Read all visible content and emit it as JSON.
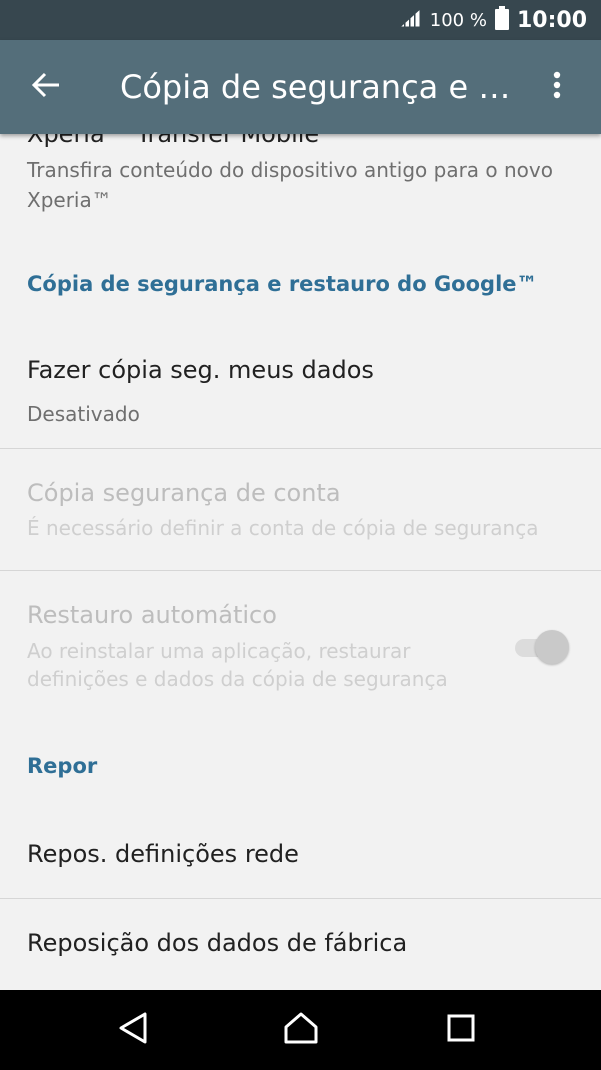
{
  "status_bar": {
    "battery_text": "100 %",
    "time": "10:00"
  },
  "app_bar": {
    "title": "Cópia de segurança e re…",
    "back_icon": "arrow-left-icon",
    "more_icon": "more-vert-icon"
  },
  "items": {
    "xperia_transfer": {
      "title": "Xperia™ Transfer Mobile",
      "summary_line1": "Transfira conteúdo do dispositivo antigo para o novo",
      "summary_line2": "Xperia™"
    },
    "google_section_header": "Cópia de segurança e restauro do Google™",
    "backup_my_data": {
      "title": "Fazer cópia seg. meus dados",
      "summary": "Desativado"
    },
    "backup_account": {
      "title": "Cópia segurança de conta",
      "summary": "É necessário definir a conta de cópia de segurança"
    },
    "auto_restore": {
      "title": "Restauro automático",
      "summary_line1": "Ao reinstalar uma aplicação, restaurar",
      "summary_line2": "definições e dados da cópia de segurança",
      "toggle_on": true
    },
    "reset_section_header": "Repor",
    "network_reset": {
      "title": "Repos. definições rede"
    },
    "factory_reset": {
      "title": "Reposição dos dados de fábrica"
    }
  },
  "colors": {
    "status_bar": "#37474f",
    "app_bar": "#546e7a",
    "accent": "#2f6f96",
    "background": "#f2f2f2"
  }
}
